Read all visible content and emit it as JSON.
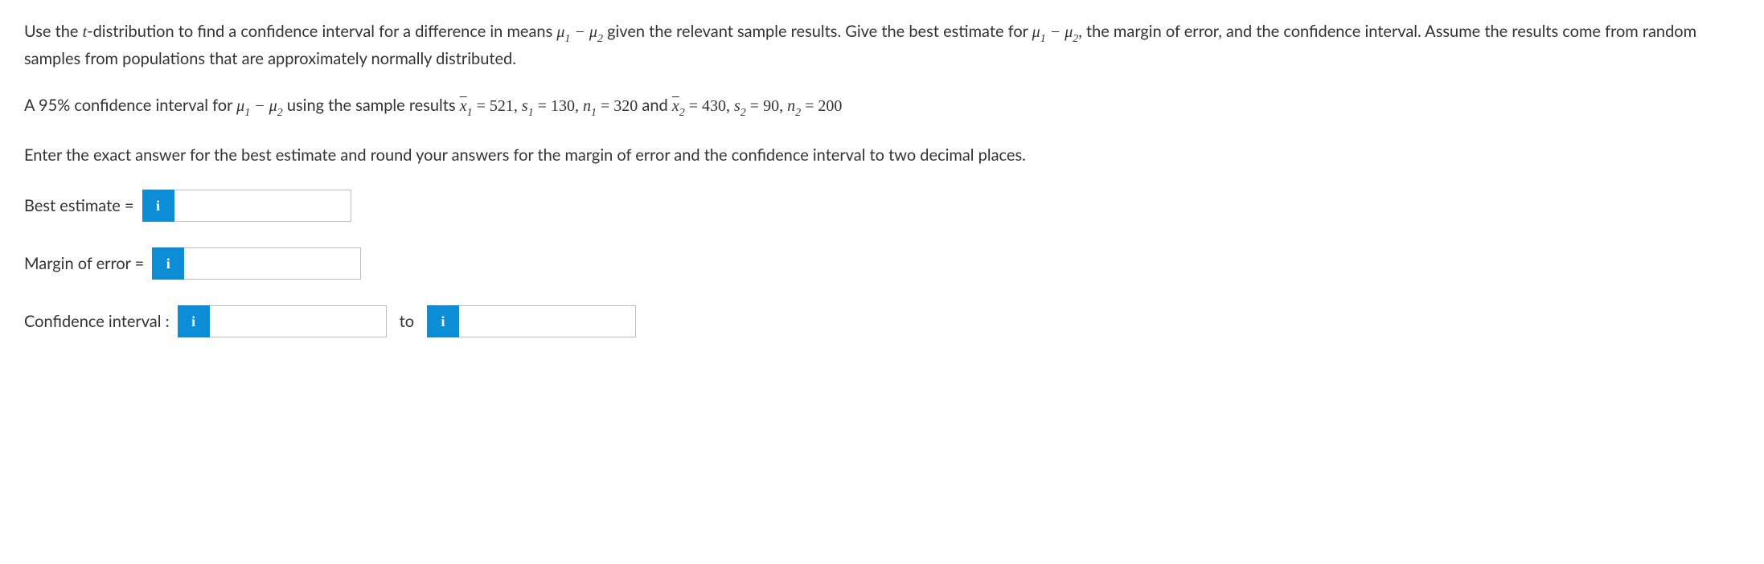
{
  "question": {
    "intro_part1": "Use the ",
    "intro_t": "t",
    "intro_part2": "-distribution to find a confidence interval for a difference in means ",
    "mu_diff": "μ₁ − μ₂",
    "intro_part3": " given the relevant sample results. Give the best estimate for ",
    "intro_part4": ", the margin of error, and the confidence interval. Assume the results come from random samples from populations that are approximately normally distributed.",
    "ci_text_part1": "A 95% confidence interval for ",
    "ci_text_part2": " using the sample results ",
    "xbar1_label": "x̄",
    "xbar1_sub": "1",
    "eq": " = ",
    "xbar1_val": "521",
    "s1_label": "s",
    "s1_sub": "1",
    "s1_val": "130",
    "n1_label": "n",
    "n1_sub": "1",
    "n1_val": "320",
    "and_text": " and ",
    "xbar2_label": "x̄",
    "xbar2_sub": "2",
    "xbar2_val": "430",
    "s2_label": "s",
    "s2_sub": "2",
    "s2_val": "90",
    "n2_label": "n",
    "n2_sub": "2",
    "n2_val": "200",
    "comma": ", ",
    "instruction": "Enter the exact answer for the best estimate and round your answers for the margin of error and the confidence interval to two decimal places."
  },
  "answers": {
    "best_estimate_label": "Best estimate = ",
    "margin_error_label": "Margin of error = ",
    "ci_label": "Confidence interval : ",
    "to_label": "to",
    "info_icon": "i",
    "best_estimate_value": "",
    "margin_error_value": "",
    "ci_lower_value": "",
    "ci_upper_value": ""
  }
}
